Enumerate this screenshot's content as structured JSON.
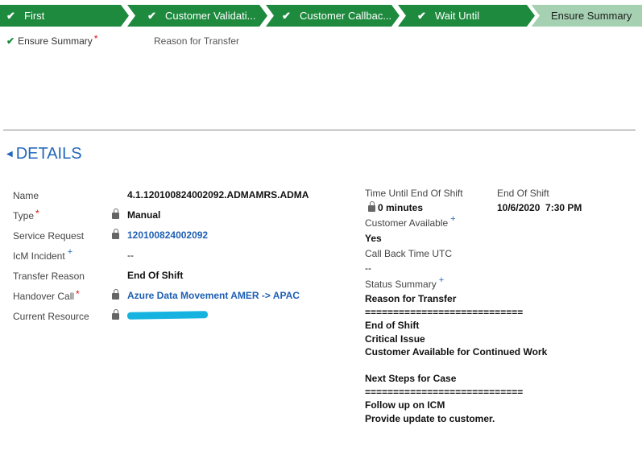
{
  "process": {
    "stages": [
      "First",
      "Customer Validati...",
      "Customer Callbac...",
      "Wait Until"
    ],
    "active_stage": "Ensure Summary"
  },
  "stage_step": {
    "label": "Ensure Summary",
    "required": "*",
    "field": "Reason for Transfer"
  },
  "details": {
    "title": "DETAILS",
    "rows": [
      {
        "label": "Name",
        "value": "4.1.120100824002092.ADMAMRS.ADMA"
      },
      {
        "label": "Type",
        "marker": "*",
        "value": "Manual"
      },
      {
        "label": "Service Request",
        "value": "120100824002092"
      },
      {
        "label": "IcM Incident",
        "marker": "+",
        "value": "--"
      },
      {
        "label": "Transfer Reason",
        "value": "End Of Shift"
      },
      {
        "label": "Handover Call",
        "marker": "*",
        "value": "Azure Data Movement AMER -> APAC"
      },
      {
        "label": "Current Resource",
        "value": ""
      }
    ],
    "right": {
      "time_until_label": "Time Until End Of Shift",
      "time_until_value": "0 minutes",
      "end_of_shift_label": "End Of Shift",
      "end_of_shift_value": "10/6/2020  7:30 PM",
      "customer_available_label": "Customer Available",
      "customer_available_marker": "+",
      "customer_available_value": "Yes",
      "callback_label": "Call Back Time UTC",
      "callback_value": "--",
      "status_summary_label": "Status Summary",
      "status_summary_marker": "+",
      "status_summary_value": "Reason for Transfer\n============================\nEnd of Shift\nCritical Issue\nCustomer Available for Continued Work\n\nNext Steps for Case\n============================\nFollow up on ICM\nProvide update to customer."
    }
  }
}
